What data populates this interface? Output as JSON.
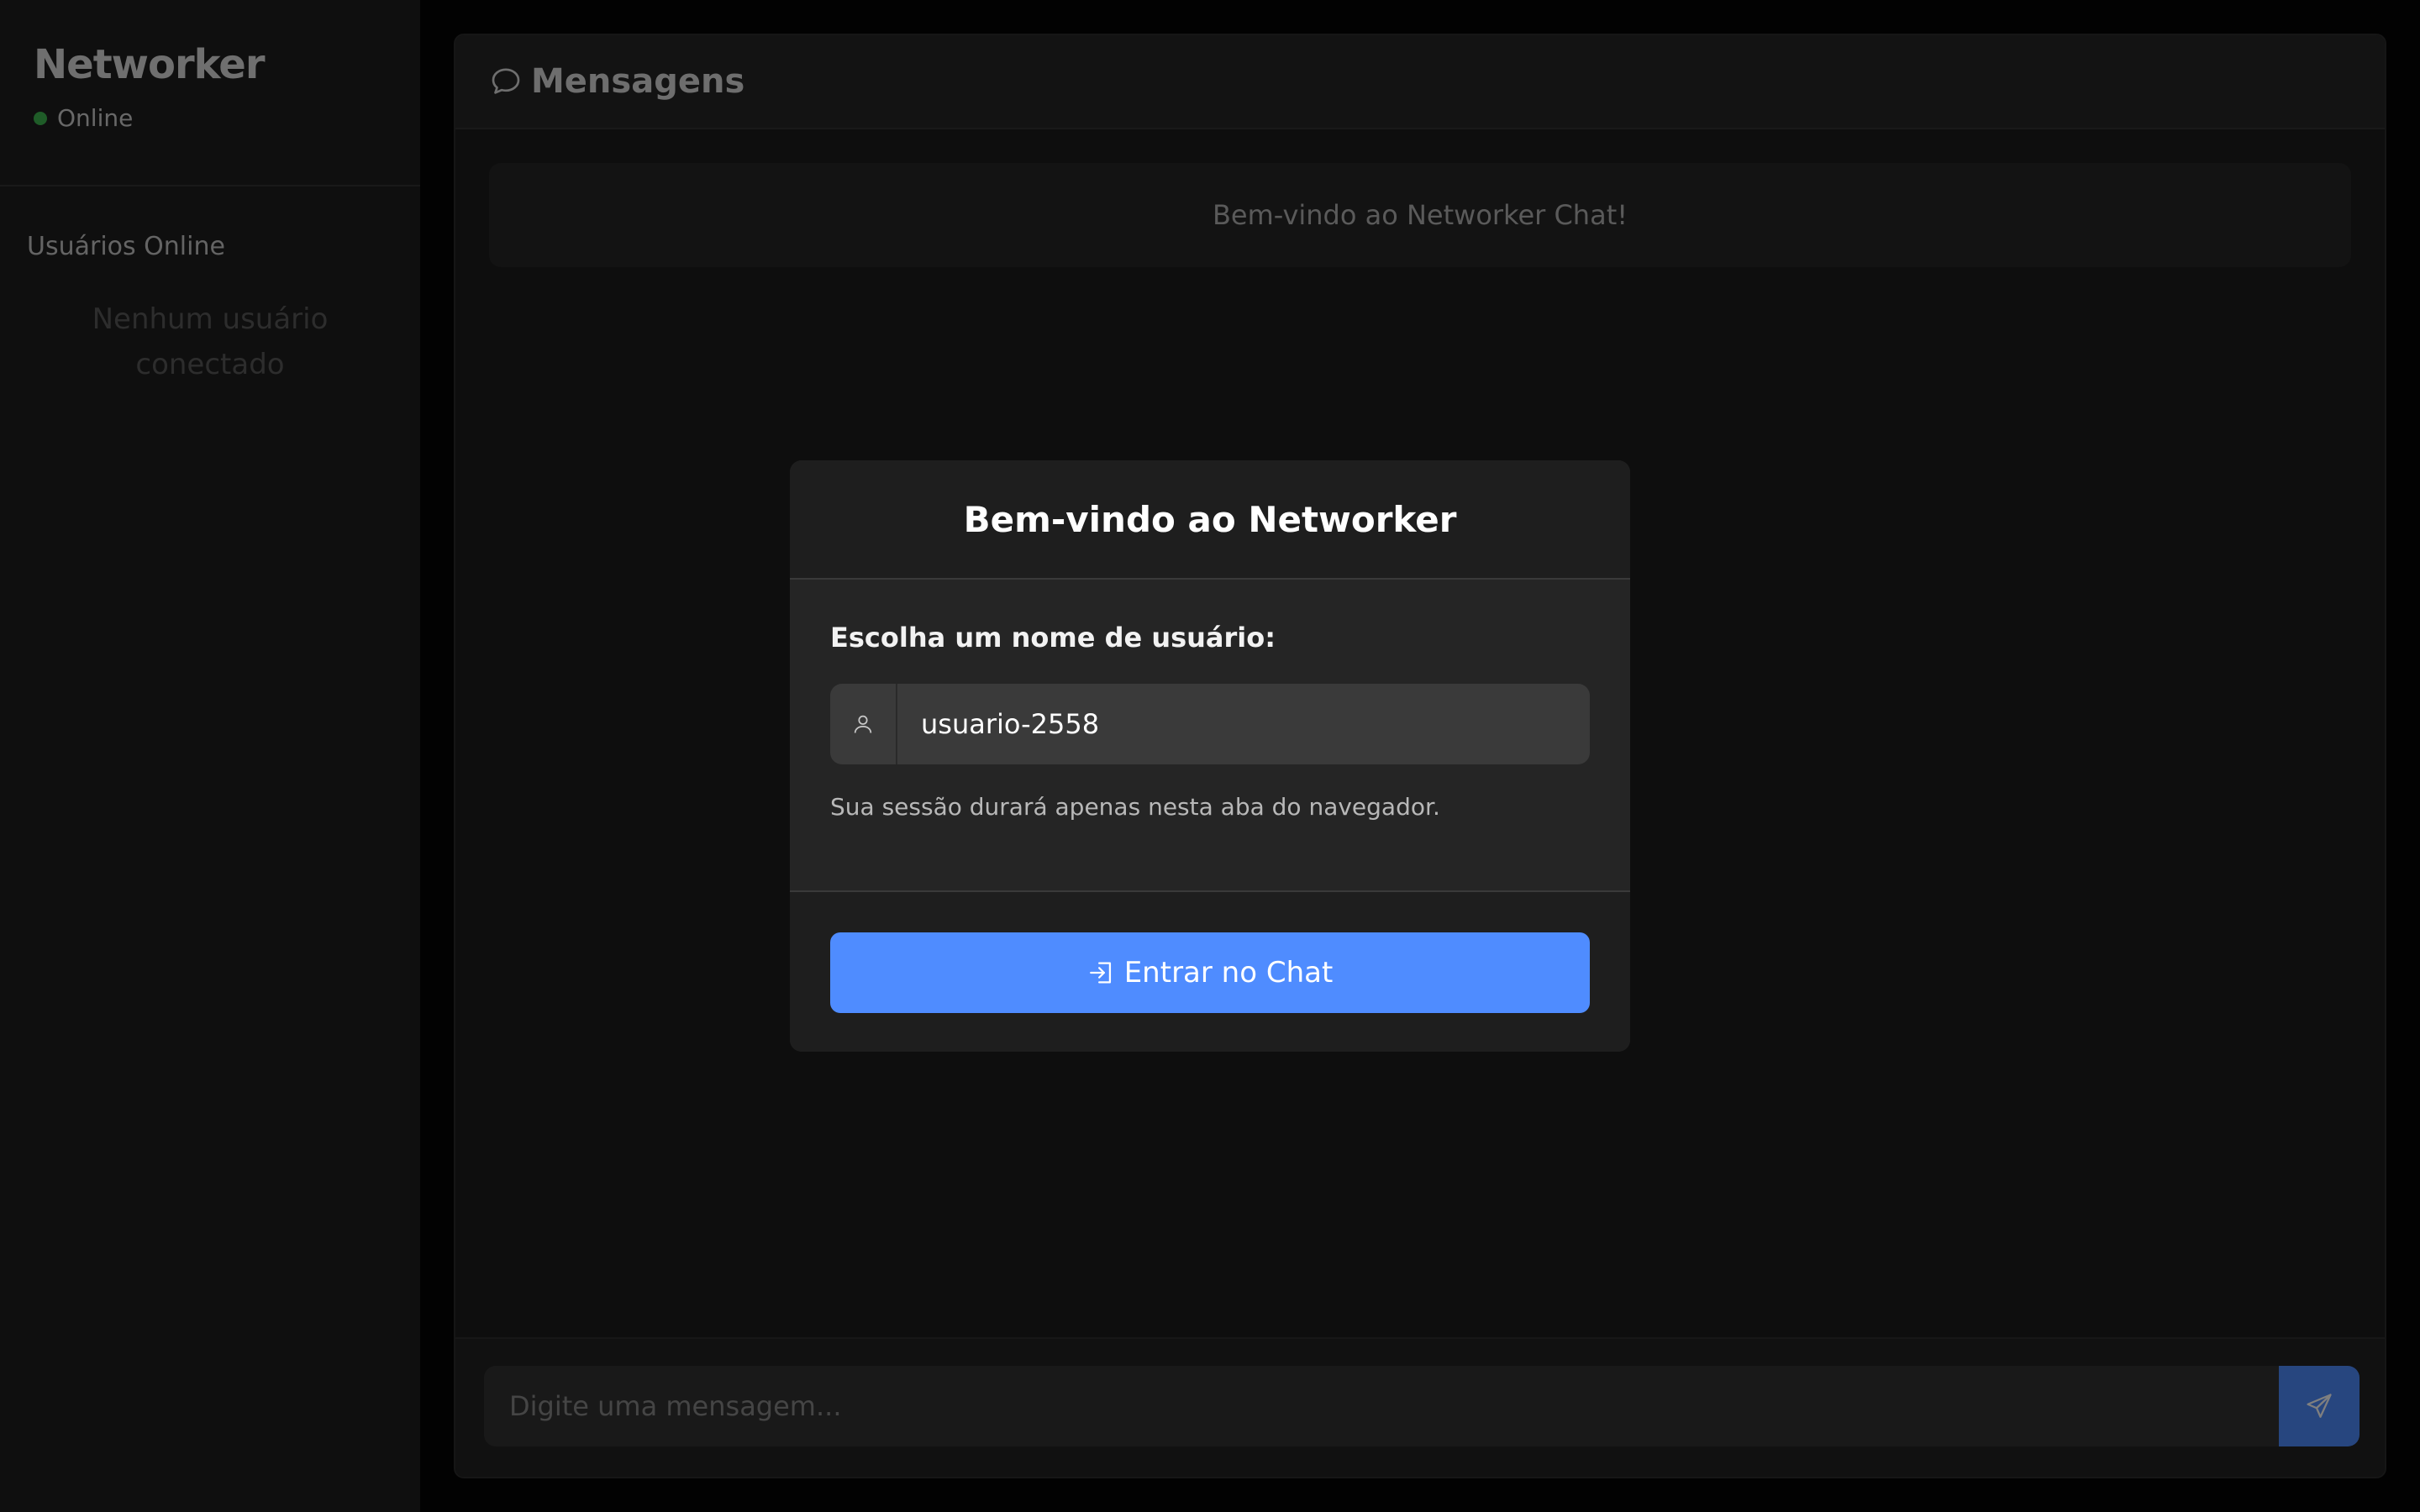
{
  "sidebar": {
    "brand": "Networker",
    "status": "Online",
    "section_title": "Usuários Online",
    "empty_message": "Nenhum usuário conectado"
  },
  "chat": {
    "title": "Mensagens",
    "welcome": "Bem-vindo ao Networker Chat!",
    "input_placeholder": "Digite uma mensagem..."
  },
  "modal": {
    "title": "Bem-vindo ao Networker",
    "field_label": "Escolha um nome de usuário:",
    "username_value": "usuario-2558",
    "helper_text": "Sua sessão durará apenas nesta aba do navegador.",
    "enter_button": "Entrar no Chat"
  },
  "icons": {
    "chat_header": "chat-bubble-icon",
    "user_addon": "user-icon",
    "enter": "login-icon",
    "send": "send-icon"
  },
  "colors": {
    "accent": "#4f8cff",
    "online": "#3fb950",
    "background": "#050505"
  }
}
